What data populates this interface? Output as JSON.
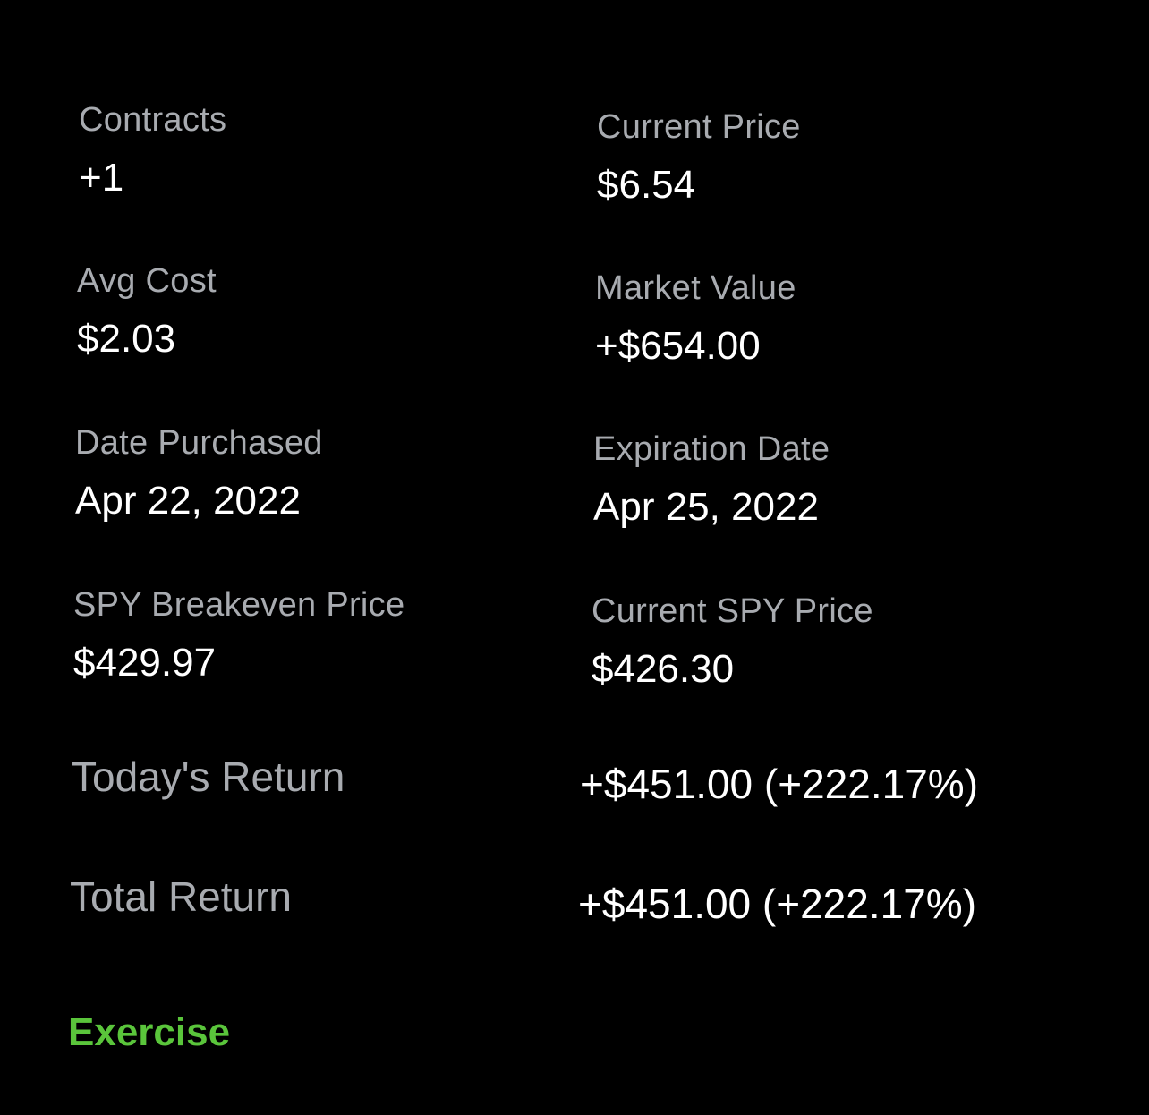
{
  "position": {
    "contracts": {
      "label": "Contracts",
      "value": "+1"
    },
    "current_price": {
      "label": "Current Price",
      "value": "$6.54"
    },
    "avg_cost": {
      "label": "Avg Cost",
      "value": "$2.03"
    },
    "market_value": {
      "label": "Market Value",
      "value": "+$654.00"
    },
    "date_purchased": {
      "label": "Date Purchased",
      "value": "Apr 22, 2022"
    },
    "expiration_date": {
      "label": "Expiration Date",
      "value": "Apr 25, 2022"
    },
    "breakeven_price": {
      "label": "SPY Breakeven Price",
      "value": "$429.97"
    },
    "current_spy_price": {
      "label": "Current SPY Price",
      "value": "$426.30"
    }
  },
  "returns": {
    "today": {
      "label": "Today's Return",
      "value": "+$451.00 (+222.17%)"
    },
    "total": {
      "label": "Total Return",
      "value": "+$451.00 (+222.17%)"
    }
  },
  "actions": {
    "exercise_label": "Exercise"
  },
  "colors": {
    "background": "#000000",
    "label": "#a8abb0",
    "value": "#ffffff",
    "accent_green": "#5ac53b"
  }
}
